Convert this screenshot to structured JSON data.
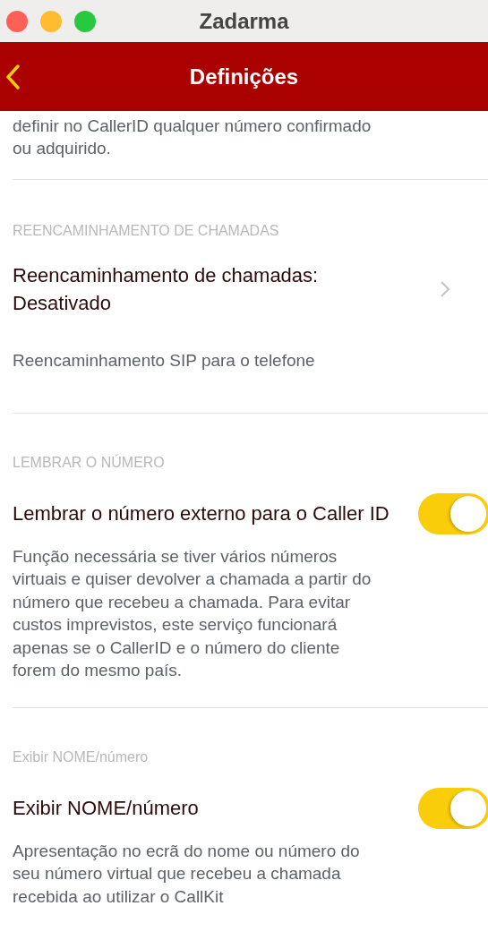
{
  "window": {
    "title": "Zadarma"
  },
  "nav": {
    "title": "Definições"
  },
  "intro_text": "definir no CallerID qualquer número confirmado ou adquirido.",
  "sections": [
    {
      "heading": "REENCAMINHAMENTO DE CHAMADAS",
      "rows": [
        {
          "kind": "link",
          "title": "Reencaminhamento de chamadas: Desativado",
          "description": "Reencaminhamento SIP para o telefone"
        }
      ]
    },
    {
      "heading": "LEMBRAR O NÚMERO",
      "rows": [
        {
          "kind": "toggle",
          "title": "Lembrar o número externo para o Caller ID",
          "on": true,
          "description": "Função necessária se tiver vários números virtuais e quiser devolver a chamada a partir do número que recebeu a chamada. Para evitar custos imprevistos, este serviço funcionará apenas se o CallerID e o número do cliente forem do mesmo país."
        }
      ]
    },
    {
      "heading": "Exibir NOME/número",
      "rows": [
        {
          "kind": "toggle",
          "title": "Exibir NOME/número",
          "on": true,
          "description": "Apresentação no ecrã do nome ou número do seu número virtual que recebeu a chamada recebida ao utilizar o CallKit"
        }
      ]
    }
  ]
}
